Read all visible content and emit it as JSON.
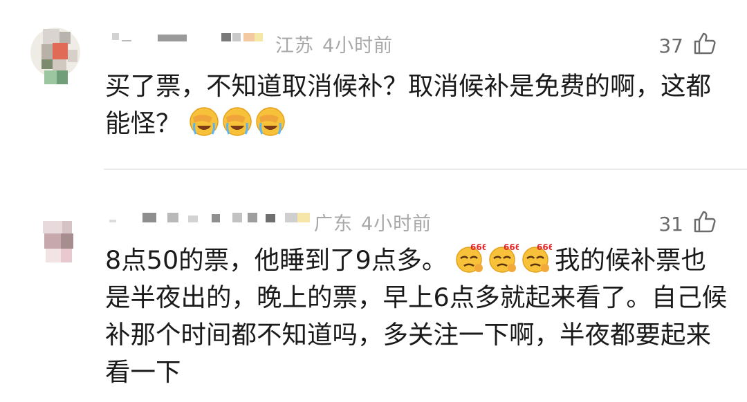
{
  "comments": [
    {
      "location": "江苏",
      "time": "4小时前",
      "likes": "37",
      "text_part1": "买了票，不知道取消候补？取消候补是免费的啊，这都能怪？",
      "emojis": [
        "facepalm-crying-emoji",
        "facepalm-crying-emoji",
        "facepalm-crying-emoji"
      ]
    },
    {
      "location": "广东",
      "time": "4小时前",
      "likes": "31",
      "text_part1": "8点50的票，他睡到了9点多。",
      "emoji_label": "666",
      "text_part2": "我的候补票也是半夜出的，晚上的票，早上6点多就起来看了。自己候补那个时间都不知道吗，多关注一下啊，半夜都要起来看一下",
      "emojis": [
        "666-emoji",
        "666-emoji",
        "666-emoji"
      ]
    }
  ]
}
